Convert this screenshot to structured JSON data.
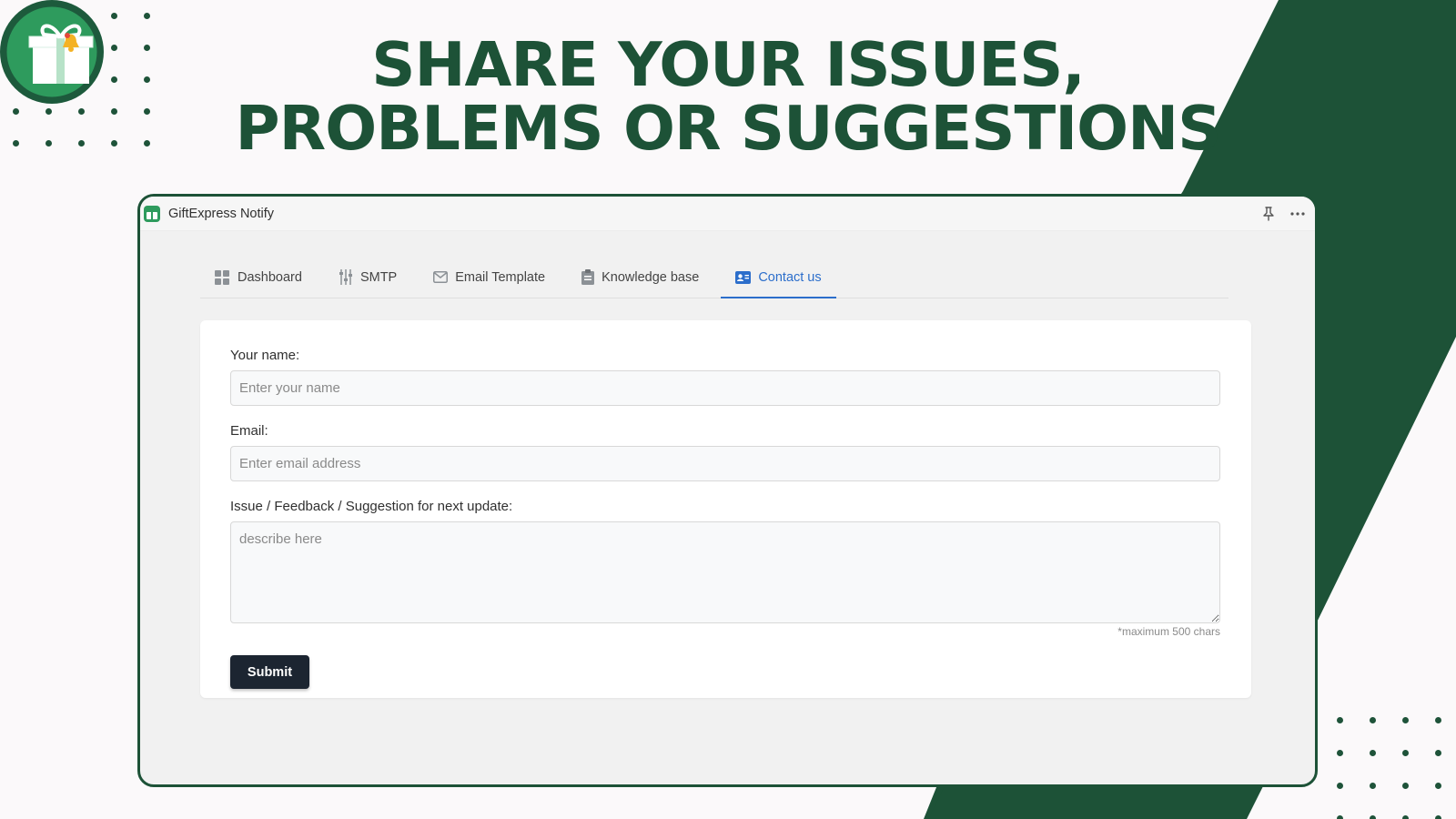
{
  "headline": {
    "line1": "SHARE YOUR ISSUES,",
    "line2": "PROBLEMS OR SUGGESTIONS"
  },
  "colors": {
    "brand_dark_green": "#1d5237",
    "logo_green": "#2e9b5d",
    "tab_active_blue": "#2c6ecb",
    "submit_button": "#1c2531"
  },
  "window": {
    "title": "GiftExpress Notify",
    "app_icon": "gift-app-icon",
    "actions": [
      "pin-icon",
      "more-icon"
    ]
  },
  "tabs": [
    {
      "label": "Dashboard",
      "icon": "dashboard-icon",
      "active": false
    },
    {
      "label": "SMTP",
      "icon": "sliders-icon",
      "active": false
    },
    {
      "label": "Email Template",
      "icon": "envelope-icon",
      "active": false
    },
    {
      "label": "Knowledge base",
      "icon": "clipboard-icon",
      "active": false
    },
    {
      "label": "Contact us",
      "icon": "contact-card-icon",
      "active": true
    }
  ],
  "form": {
    "name_label": "Your name:",
    "name_placeholder": "Enter your name",
    "name_value": "",
    "email_label": "Email:",
    "email_placeholder": "Enter email address",
    "email_value": "",
    "issue_label": "Issue / Feedback / Suggestion for next update:",
    "issue_placeholder": "describe here",
    "issue_value": "",
    "char_hint": "*maximum 500 chars",
    "submit_label": "Submit"
  }
}
